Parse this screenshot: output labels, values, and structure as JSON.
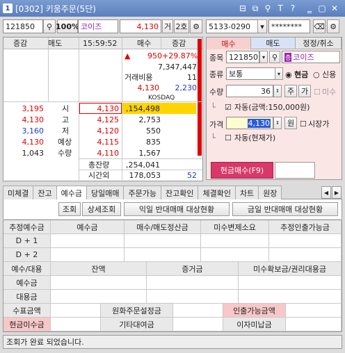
{
  "window": {
    "number": "1",
    "title": "[0302] 키움주문(5단)",
    "icons": [
      "layout-icon",
      "dual-window-icon",
      "link-icon",
      "text-size-icon",
      "help-icon",
      "minimize-icon",
      "maximize-icon",
      "close-icon"
    ],
    "glyphs": [
      "⊟",
      "⧉",
      "⚲",
      "T",
      "?",
      "‗",
      "▢",
      "✕"
    ]
  },
  "toolbar": {
    "code": "121850",
    "pct": "100%",
    "name": "코이즈",
    "price": "4,130",
    "geo": "거",
    "ho": "2호",
    "account": "5133-0290",
    "password": "********"
  },
  "orderbook": {
    "headers": {
      "change1": "증감",
      "sell": "매도",
      "time": "15:59:52",
      "buy": "매수",
      "change2": "증감"
    },
    "summary": {
      "top_price": "950",
      "top_rate": "+29.87%",
      "volume": "7,347,447",
      "cost_label": "거래비용",
      "cost_value": "11",
      "price": "4,130",
      "index": "2,230",
      "market": "KOSDAQ"
    },
    "rows": [
      {
        "sell": "3,195",
        "label": "시",
        "price": "4,130",
        "buy": ",154,498"
      },
      {
        "sell": "4,130",
        "label": "고",
        "price": "4,125",
        "buy": "2,753"
      },
      {
        "sell": "3,160",
        "label": "저",
        "price": "4,120",
        "buy": "550"
      },
      {
        "sell": "4,130",
        "label": "예상",
        "price": "4,115",
        "buy": "835"
      },
      {
        "sell": "1,043",
        "label": "수량",
        "price": "4,110",
        "buy": "1,567"
      }
    ],
    "footer": [
      {
        "label": "총잔량",
        "value": ",254,041",
        "extra": ""
      },
      {
        "label": "시간외",
        "value": "178,053",
        "extra": "52"
      }
    ]
  },
  "order_panel": {
    "tabs": [
      "매수",
      "매도",
      "정정/취소"
    ],
    "code_label": "종목",
    "code": "121850",
    "name": "코이즈",
    "type_label": "종류",
    "type_value": "보통",
    "radio_cash": "현금",
    "radio_credit": "신용",
    "qty_label": "수량",
    "qty": "36",
    "unit": "주",
    "avail_btn": "가",
    "unfilled": "미수",
    "auto_text": "자동(금액:150,000원)",
    "price_label": "가격",
    "price": "4,130",
    "won": "원",
    "market_price": "시장가",
    "auto_current": "자동(현재가)",
    "submit": "현금매수(F9)"
  },
  "tabs": [
    "미체결",
    "잔고",
    "예수금",
    "당일매매",
    "주문가능",
    "잔고확인",
    "체결확인",
    "차트",
    "원장"
  ],
  "active_tab": "예수금",
  "actions": [
    "조회",
    "상세조회",
    "익일 반대매매 대상현황",
    "금일 반대매매 대상현황"
  ],
  "grid": {
    "headers1": [
      "추정예수금",
      "예수금",
      "매수/매도정산금",
      "미수변제소요",
      "추정인출가능금"
    ],
    "rows1": [
      "D + 1",
      "D + 2"
    ],
    "headers2": [
      "예수/대용",
      "잔액",
      "증거금",
      "미수확보금/권리대용금"
    ],
    "rows2": [
      "예수금",
      "대용금"
    ],
    "bottom": {
      "label1": "수표금액",
      "label2": "원화주문설정금",
      "label3": "인출가능금액",
      "label4": "현금미수금",
      "label5": "기타대여금",
      "label6": "이자미납금"
    }
  },
  "status": "조회가 완료 되었습니다.",
  "colors": {
    "title": "#5b7fbd",
    "up": "#e00000",
    "down": "#1a3cc8",
    "buy_panel": "#fbe6e6",
    "submit": "#d9386a",
    "highlight": "#ffd400"
  }
}
